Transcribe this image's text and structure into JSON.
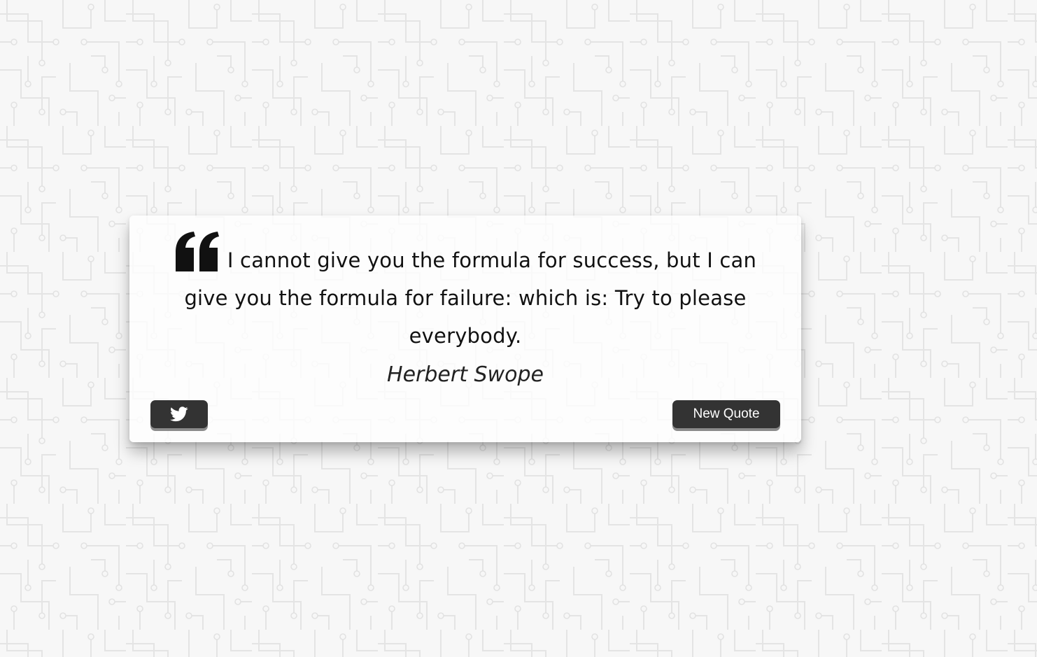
{
  "quote": {
    "text": "I cannot give you the formula for success, but I can give you the formula for failure: which is: Try to please everybody.",
    "author": "Herbert Swope"
  },
  "buttons": {
    "tweet_icon": "twitter-icon",
    "new_quote_label": "New Quote"
  },
  "icons": {
    "quote_mark": "quote-left-icon"
  },
  "colors": {
    "button_bg": "#333333",
    "button_text": "#ffffff",
    "text": "#111111",
    "background": "#f7f7f7"
  }
}
